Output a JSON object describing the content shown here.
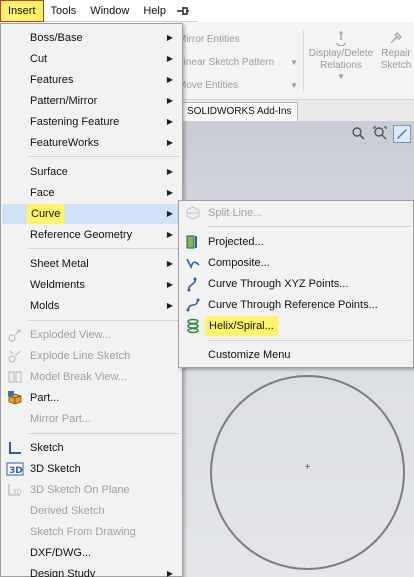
{
  "menubar": {
    "items": [
      {
        "label": "Insert",
        "active": true
      },
      {
        "label": "Tools"
      },
      {
        "label": "Window"
      },
      {
        "label": "Help"
      }
    ],
    "pin_icon": "pin-icon"
  },
  "ribbon": {
    "mirror_entities": "Mirror Entities",
    "linear_pattern": "Linear Sketch Pattern",
    "move_entities": "Move Entities",
    "display_delete_line1": "Display/Delete",
    "display_delete_line2": "Relations",
    "repair_line1": "Repair",
    "repair_line2": "Sketch"
  },
  "tabs": {
    "addins": "SOLIDWORKS Add-Ins"
  },
  "insert_menu": {
    "items": [
      {
        "label": "Boss/Base",
        "submenu": true
      },
      {
        "label": "Cut",
        "submenu": true
      },
      {
        "label": "Features",
        "submenu": true
      },
      {
        "label": "Pattern/Mirror",
        "submenu": true
      },
      {
        "label": "Fastening Feature",
        "submenu": true
      },
      {
        "label": "FeatureWorks",
        "submenu": true
      },
      {
        "label": "Surface",
        "submenu": true
      },
      {
        "label": "Face",
        "submenu": true
      },
      {
        "label": "Curve",
        "submenu": true,
        "highlighted": true
      },
      {
        "label": "Reference Geometry",
        "submenu": true
      },
      {
        "label": "Sheet Metal",
        "submenu": true
      },
      {
        "label": "Weldments",
        "submenu": true
      },
      {
        "label": "Molds",
        "submenu": true
      },
      {
        "label": "Exploded View...",
        "disabled": true,
        "icon": "exploded-view-icon"
      },
      {
        "label": "Explode Line Sketch",
        "disabled": true,
        "icon": "explode-line-icon"
      },
      {
        "label": "Model Break View...",
        "disabled": true,
        "icon": "model-break-icon"
      },
      {
        "label": "Part...",
        "icon": "part-icon"
      },
      {
        "label": "Mirror Part...",
        "disabled": true
      },
      {
        "label": "Sketch",
        "icon": "sketch-icon"
      },
      {
        "label": "3D Sketch",
        "icon": "3d-sketch-icon"
      },
      {
        "label": "3D Sketch On Plane",
        "disabled": true,
        "icon": "3d-sketch-plane-icon"
      },
      {
        "label": "Derived Sketch",
        "disabled": true
      },
      {
        "label": "Sketch From Drawing",
        "disabled": true
      },
      {
        "label": "DXF/DWG..."
      },
      {
        "label": "Design Study",
        "submenu": true
      }
    ],
    "arrow": "▶",
    "highlight_color": "#fff36a"
  },
  "curve_submenu": {
    "items": [
      {
        "label": "Split Line...",
        "disabled": true,
        "icon": "split-line-icon"
      },
      {
        "label": "Projected...",
        "icon": "projected-curve-icon"
      },
      {
        "label": "Composite...",
        "icon": "composite-curve-icon"
      },
      {
        "label": "Curve Through XYZ Points...",
        "icon": "xyz-curve-icon"
      },
      {
        "label": "Curve Through Reference Points...",
        "icon": "reference-points-curve-icon"
      },
      {
        "label": "Helix/Spiral...",
        "icon": "helix-icon",
        "highlighted": true
      },
      {
        "label": "Customize Menu"
      }
    ]
  },
  "viewport": {
    "center_mark": "+"
  }
}
